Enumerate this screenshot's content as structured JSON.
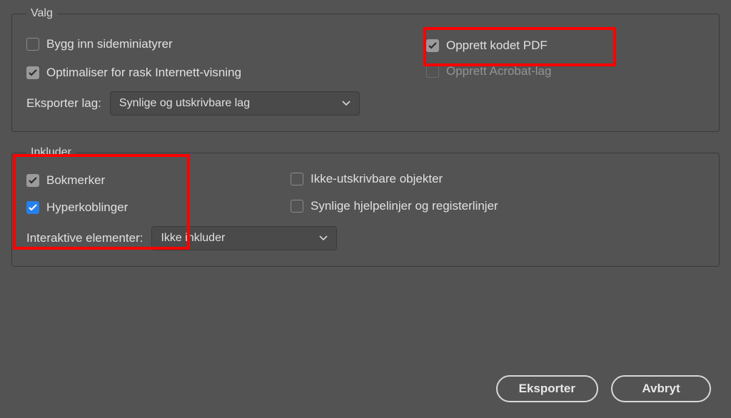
{
  "valg": {
    "legend": "Valg",
    "emb": "Bygg inn sideminiatyrer",
    "opt": "Optimaliser for rask Internett-visning",
    "tagged": "Opprett kodet PDF",
    "acrobat": "Opprett Acrobat-lag",
    "layers_label": "Eksporter lag:",
    "layers_value": "Synlige og utskrivbare lag"
  },
  "inkluder": {
    "legend": "Inkluder",
    "bookmarks": "Bokmerker",
    "hyperlinks": "Hyperkoblinger",
    "nonprint": "Ikke-utskrivbare objekter",
    "guides": "Synlige hjelpelinjer og registerlinjer",
    "interactive_label": "Interaktive elementer:",
    "interactive_value": "Ikke inkluder"
  },
  "buttons": {
    "export": "Eksporter",
    "cancel": "Avbryt"
  }
}
